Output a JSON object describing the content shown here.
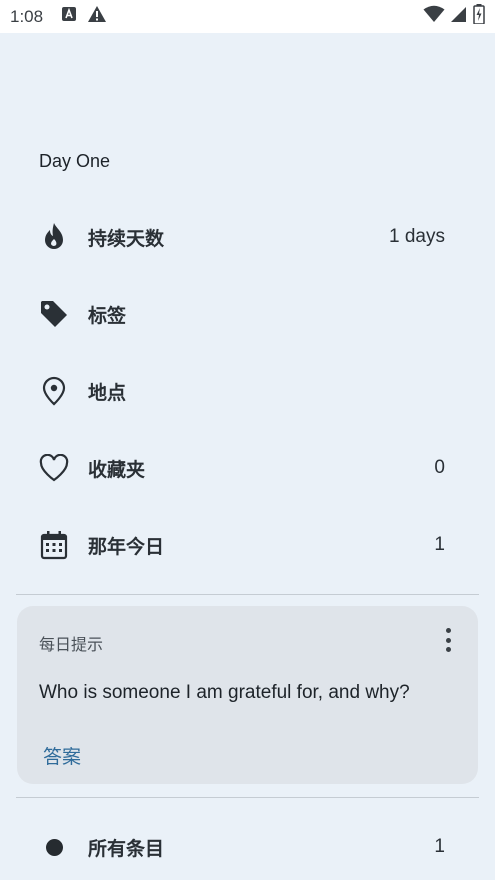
{
  "status_bar": {
    "time": "1:08",
    "icons": [
      "a-notification-icon",
      "warning-icon",
      "wifi-icon",
      "signal-icon",
      "battery-charging-icon"
    ]
  },
  "drawer": {
    "journal_name": "Day One",
    "nav_items": [
      {
        "icon": "flame-icon",
        "label": "持续天数",
        "count": "1 days"
      },
      {
        "icon": "tag-icon",
        "label": "标签",
        "count": ""
      },
      {
        "icon": "location-pin-icon",
        "label": "地点",
        "count": ""
      },
      {
        "icon": "heart-icon",
        "label": "收藏夹",
        "count": "0"
      },
      {
        "icon": "calendar-icon",
        "label": "那年今日",
        "count": "1"
      }
    ],
    "daily_prompt": {
      "heading": "每日提示",
      "text": "Who is someone I am grateful for, and why?",
      "answer_label": "答案"
    },
    "all_entries": {
      "icon": "dot-icon",
      "label": "所有条目",
      "count": "1"
    }
  },
  "colors": {
    "background": "#eaf1f8",
    "card": "#dfe4ea",
    "accent_link": "#2f6b9a",
    "text": "#1d2329"
  }
}
